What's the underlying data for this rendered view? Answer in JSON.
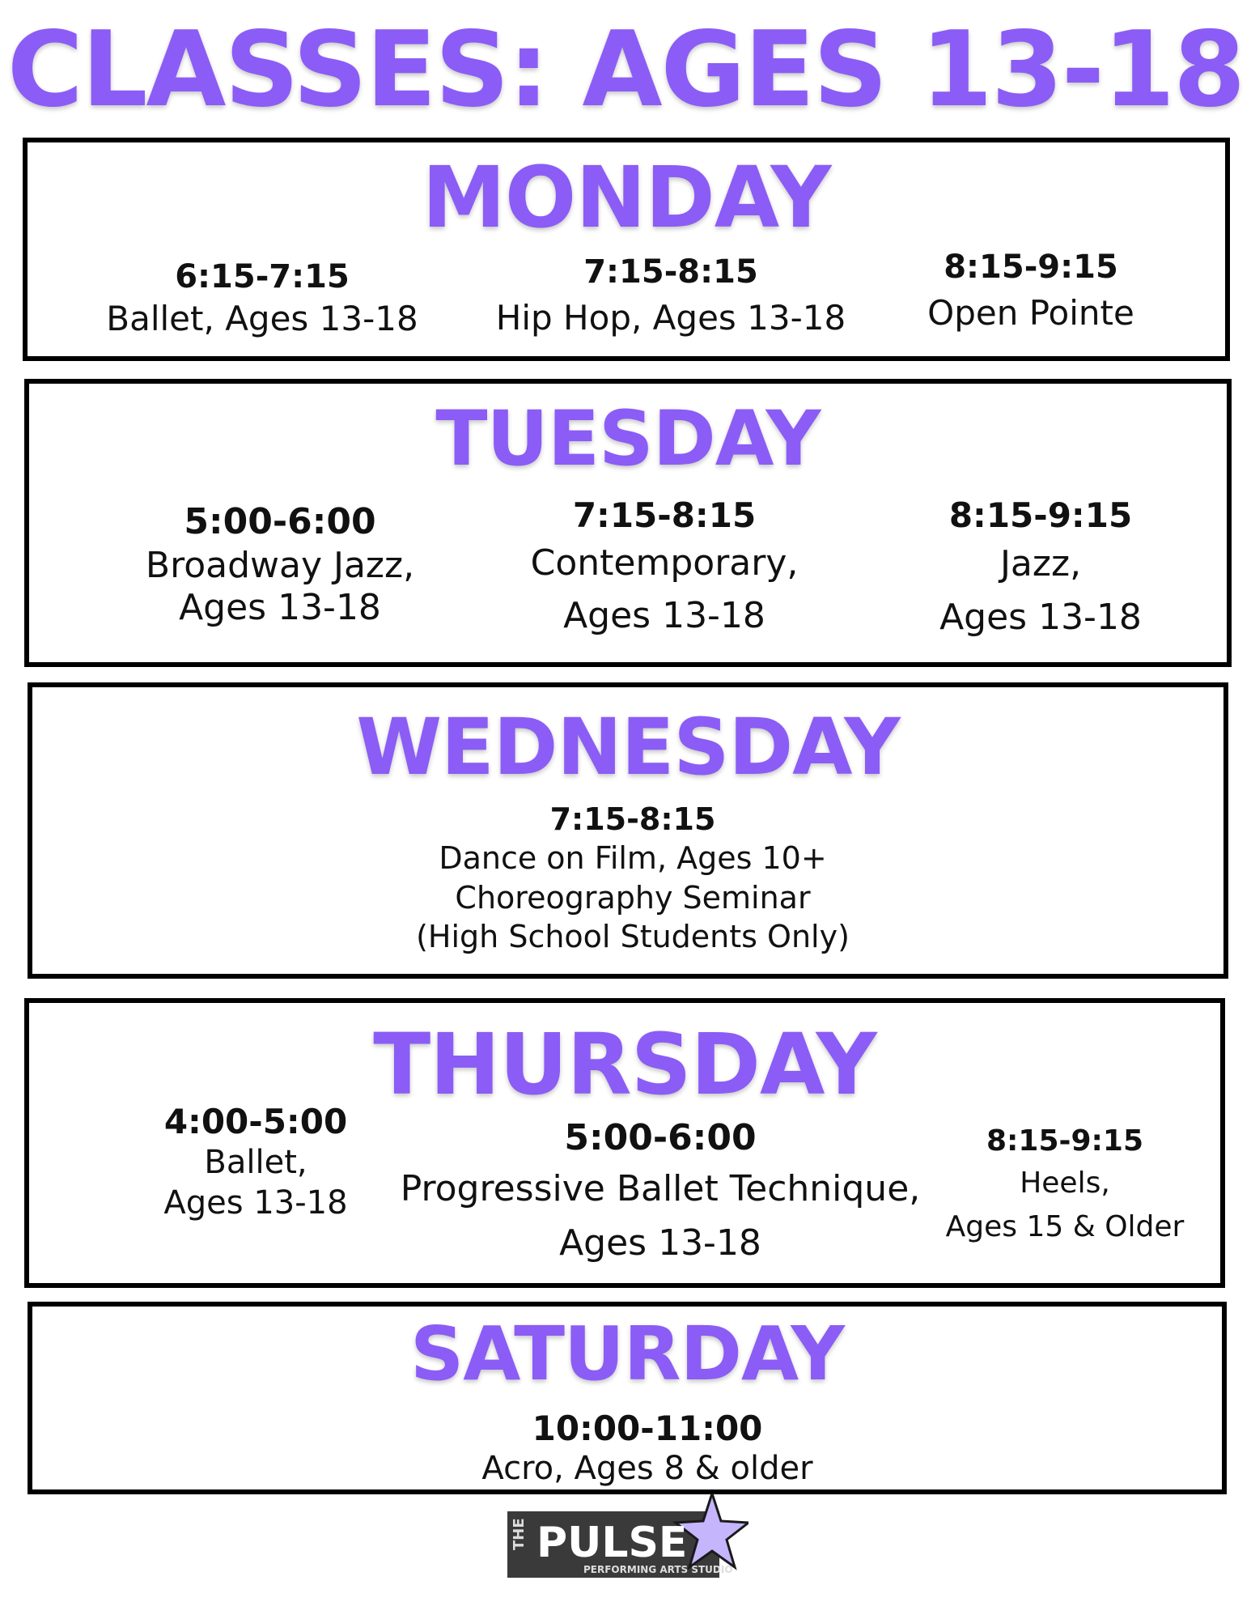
{
  "title": "CLASSES: AGES 13-18",
  "days": {
    "monday": {
      "name": "MONDAY",
      "classes": [
        {
          "time": "6:15-7:15",
          "lines": [
            "Ballet, Ages 13-18"
          ]
        },
        {
          "time": "7:15-8:15",
          "lines": [
            "Hip Hop, Ages 13-18"
          ]
        },
        {
          "time": "8:15-9:15",
          "lines": [
            "Open Pointe"
          ]
        }
      ]
    },
    "tuesday": {
      "name": "TUESDAY",
      "classes": [
        {
          "time": "5:00-6:00",
          "lines": [
            "Broadway Jazz,",
            "Ages 13-18"
          ]
        },
        {
          "time": "7:15-8:15",
          "lines": [
            "Contemporary,",
            "Ages 13-18"
          ]
        },
        {
          "time": "8:15-9:15",
          "lines": [
            "Jazz,",
            "Ages 13-18"
          ]
        }
      ]
    },
    "wednesday": {
      "name": "WEDNESDAY",
      "classes": [
        {
          "time": "7:15-8:15",
          "lines": [
            "Dance on Film, Ages 10+",
            "Choreography Seminar",
            "(High School Students Only)"
          ]
        }
      ]
    },
    "thursday": {
      "name": "THURSDAY",
      "classes": [
        {
          "time": "4:00-5:00",
          "lines": [
            "Ballet,",
            "Ages 13-18"
          ]
        },
        {
          "time": "5:00-6:00",
          "lines": [
            "Progressive Ballet Technique,",
            "Ages 13-18"
          ]
        },
        {
          "time": "8:15-9:15",
          "lines": [
            "Heels,",
            "Ages 15 & Older"
          ]
        }
      ]
    },
    "saturday": {
      "name": "SATURDAY",
      "classes": [
        {
          "time": "10:00-11:00",
          "lines": [
            "Acro, Ages 8 & older"
          ]
        }
      ]
    }
  },
  "logo": {
    "the": "THE",
    "name": "PULSE",
    "subtitle": "PERFORMING ARTS STUDIO",
    "icon": "star-icon"
  },
  "colors": {
    "accent": "#8b5cf6",
    "text": "#111111",
    "border": "#000000",
    "logo_dark": "#3a3a3a",
    "star": "#c4b5fd"
  }
}
